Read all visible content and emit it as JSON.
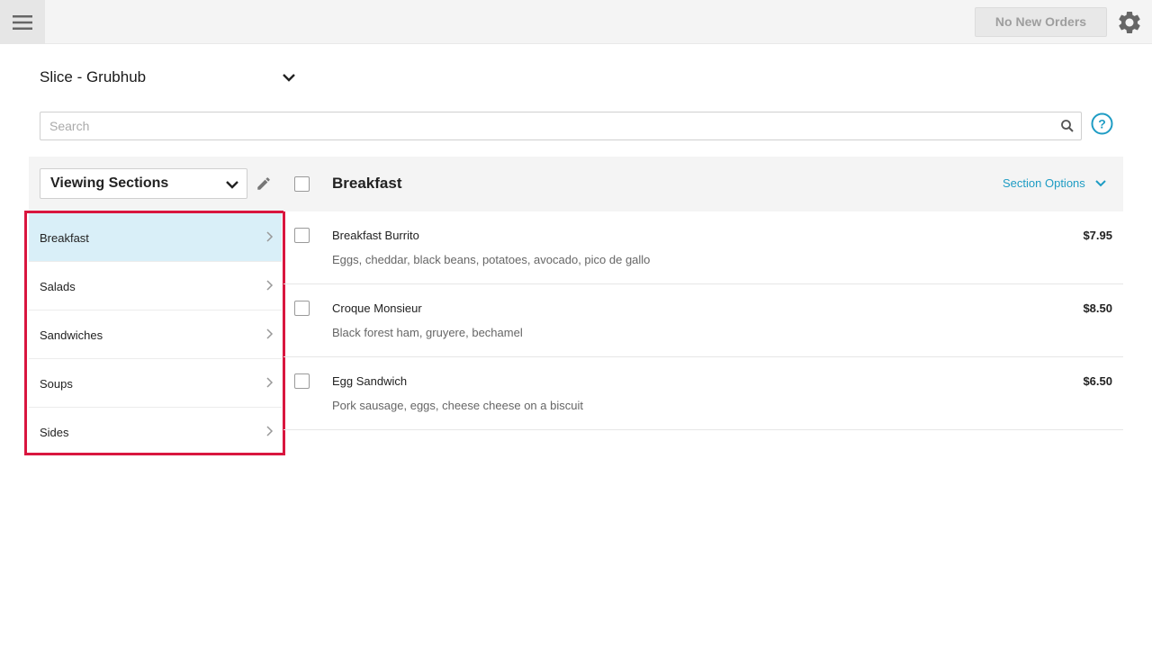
{
  "header": {
    "menu_icon": "hamburger-menu-icon",
    "orders_label": "No New Orders",
    "settings_icon": "gear-icon"
  },
  "restaurant": {
    "name": "Slice - Grubhub",
    "icon": "chevron-down-icon"
  },
  "search": {
    "placeholder": "Search",
    "value": "",
    "icon": "search-icon",
    "help_icon": "help-icon"
  },
  "sidebar": {
    "view_select_label": "Viewing Sections",
    "edit_icon": "pencil-icon",
    "items": [
      {
        "label": "Breakfast",
        "active": true
      },
      {
        "label": "Salads",
        "active": false
      },
      {
        "label": "Sandwiches",
        "active": false
      },
      {
        "label": "Soups",
        "active": false
      },
      {
        "label": "Sides",
        "active": false
      }
    ]
  },
  "main": {
    "title": "Breakfast",
    "section_options_label": "Section Options",
    "items": [
      {
        "name": "Breakfast Burrito",
        "description": "Eggs, cheddar, black beans, potatoes, avocado, pico de gallo",
        "price": "$7.95"
      },
      {
        "name": "Croque Monsieur",
        "description": "Black forest ham, gruyere, bechamel",
        "price": "$8.50"
      },
      {
        "name": "Egg Sandwich",
        "description": "Pork sausage, eggs, cheese cheese on a biscuit",
        "price": "$6.50"
      }
    ]
  },
  "colors": {
    "accent": "#1e9cc4",
    "highlight_border": "#d9163f",
    "active_row": "#d9eff8"
  }
}
